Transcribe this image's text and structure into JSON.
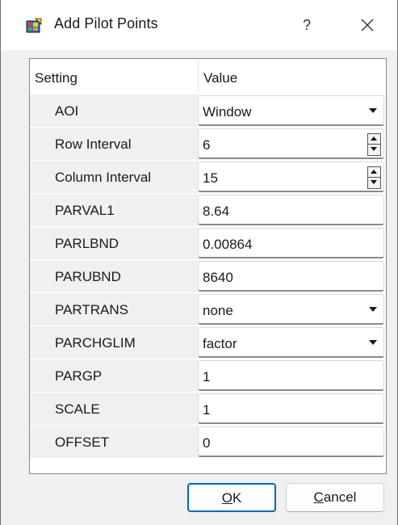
{
  "window": {
    "title": "Add Pilot Points",
    "help_label": "?",
    "close_icon": "close-icon",
    "app_icon": "app-icon"
  },
  "table": {
    "columns": [
      "Setting",
      "Value"
    ],
    "rows": [
      {
        "setting": "AOI",
        "value": "Window",
        "control": "combo"
      },
      {
        "setting": "Row Interval",
        "value": "6",
        "control": "spin"
      },
      {
        "setting": "Column Interval",
        "value": "15",
        "control": "spin"
      },
      {
        "setting": "PARVAL1",
        "value": "8.64",
        "control": "text"
      },
      {
        "setting": "PARLBND",
        "value": "0.00864",
        "control": "text"
      },
      {
        "setting": "PARUBND",
        "value": "8640",
        "control": "text"
      },
      {
        "setting": "PARTRANS",
        "value": "none",
        "control": "combo"
      },
      {
        "setting": "PARCHGLIM",
        "value": "factor",
        "control": "combo"
      },
      {
        "setting": "PARGP",
        "value": "1",
        "control": "text"
      },
      {
        "setting": "SCALE",
        "value": "1",
        "control": "text"
      },
      {
        "setting": "OFFSET",
        "value": "0",
        "control": "text"
      }
    ]
  },
  "buttons": {
    "ok_first": "O",
    "ok_rest": "K",
    "cancel_first": "C",
    "cancel_rest": "ancel"
  },
  "colors": {
    "accent": "#0067c0",
    "label_bg": "#f0f0f0"
  }
}
